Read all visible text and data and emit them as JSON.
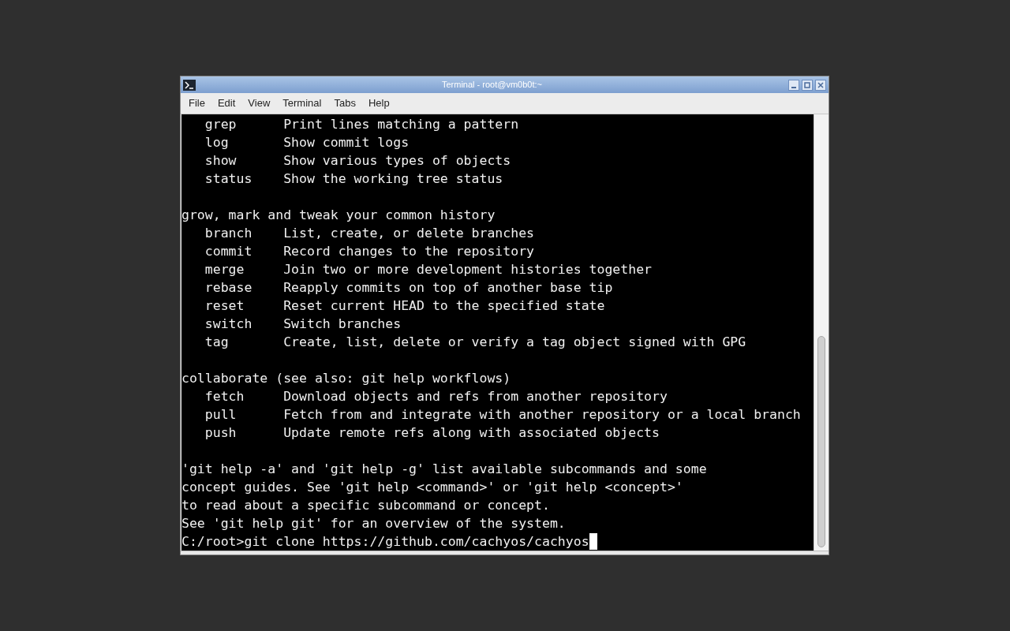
{
  "window": {
    "title": "Terminal - root@vm0b0t:~"
  },
  "menu": [
    "File",
    "Edit",
    "View",
    "Terminal",
    "Tabs",
    "Help"
  ],
  "terminal": {
    "lines": [
      {
        "kind": "text",
        "text": "   grep      Print lines matching a pattern"
      },
      {
        "kind": "text",
        "text": "   log       Show commit logs"
      },
      {
        "kind": "text",
        "text": "   show      Show various types of objects"
      },
      {
        "kind": "text",
        "text": "   status    Show the working tree status"
      },
      {
        "kind": "blank"
      },
      {
        "kind": "text",
        "text": "grow, mark and tweak your common history"
      },
      {
        "kind": "text",
        "text": "   branch    List, create, or delete branches"
      },
      {
        "kind": "text",
        "text": "   commit    Record changes to the repository"
      },
      {
        "kind": "text",
        "text": "   merge     Join two or more development histories together"
      },
      {
        "kind": "text",
        "text": "   rebase    Reapply commits on top of another base tip"
      },
      {
        "kind": "text",
        "text": "   reset     Reset current HEAD to the specified state"
      },
      {
        "kind": "text",
        "text": "   switch    Switch branches"
      },
      {
        "kind": "text",
        "text": "   tag       Create, list, delete or verify a tag object signed with GPG"
      },
      {
        "kind": "blank"
      },
      {
        "kind": "text",
        "text": "collaborate (see also: git help workflows)"
      },
      {
        "kind": "text",
        "text": "   fetch     Download objects and refs from another repository"
      },
      {
        "kind": "text",
        "text": "   pull      Fetch from and integrate with another repository or a local branch"
      },
      {
        "kind": "text",
        "text": "   push      Update remote refs along with associated objects"
      },
      {
        "kind": "blank"
      },
      {
        "kind": "text",
        "text": "'git help -a' and 'git help -g' list available subcommands and some"
      },
      {
        "kind": "text",
        "text": "concept guides. See 'git help <command>' or 'git help <concept>'"
      },
      {
        "kind": "text",
        "text": "to read about a specific subcommand or concept."
      },
      {
        "kind": "text",
        "text": "See 'git help git' for an overview of the system."
      },
      {
        "kind": "prompt",
        "text": "C:/root>git clone https://github.com/cachyos/cachyos"
      }
    ]
  }
}
